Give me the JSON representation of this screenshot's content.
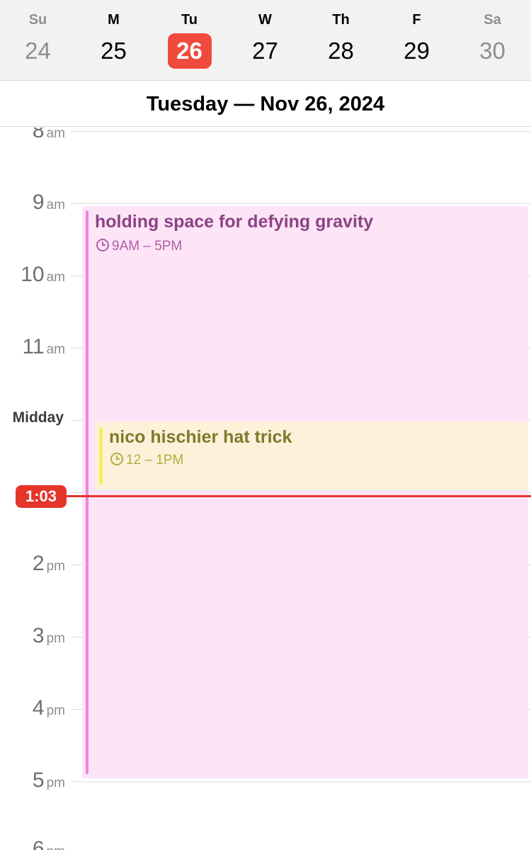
{
  "week": {
    "days": [
      {
        "dow": "Su",
        "num": "24"
      },
      {
        "dow": "M",
        "num": "25"
      },
      {
        "dow": "Tu",
        "num": "26"
      },
      {
        "dow": "W",
        "num": "27"
      },
      {
        "dow": "Th",
        "num": "28"
      },
      {
        "dow": "F",
        "num": "29"
      },
      {
        "dow": "Sa",
        "num": "30"
      }
    ],
    "today_color": "#f04a3e"
  },
  "date_header": "Tuesday — Nov 26, 2024",
  "timeline": {
    "hours": [
      {
        "h": "8",
        "s": "am"
      },
      {
        "h": "9",
        "s": "am"
      },
      {
        "h": "10",
        "s": "am"
      },
      {
        "h": "11",
        "s": "am"
      },
      {
        "midday": "Midday"
      },
      {
        "h": "2",
        "s": "pm"
      },
      {
        "h": "3",
        "s": "pm"
      },
      {
        "h": "4",
        "s": "pm"
      },
      {
        "h": "5",
        "s": "pm"
      },
      {
        "h": "6",
        "s": "pm"
      }
    ],
    "now_label": "1:03"
  },
  "events": [
    {
      "title": "holding space for defying gravity",
      "time": "9AM – 5PM",
      "color": "#ec84dc"
    },
    {
      "title": "nico hischier hat trick",
      "time": "12 – 1PM",
      "color": "#f7ef62"
    }
  ]
}
